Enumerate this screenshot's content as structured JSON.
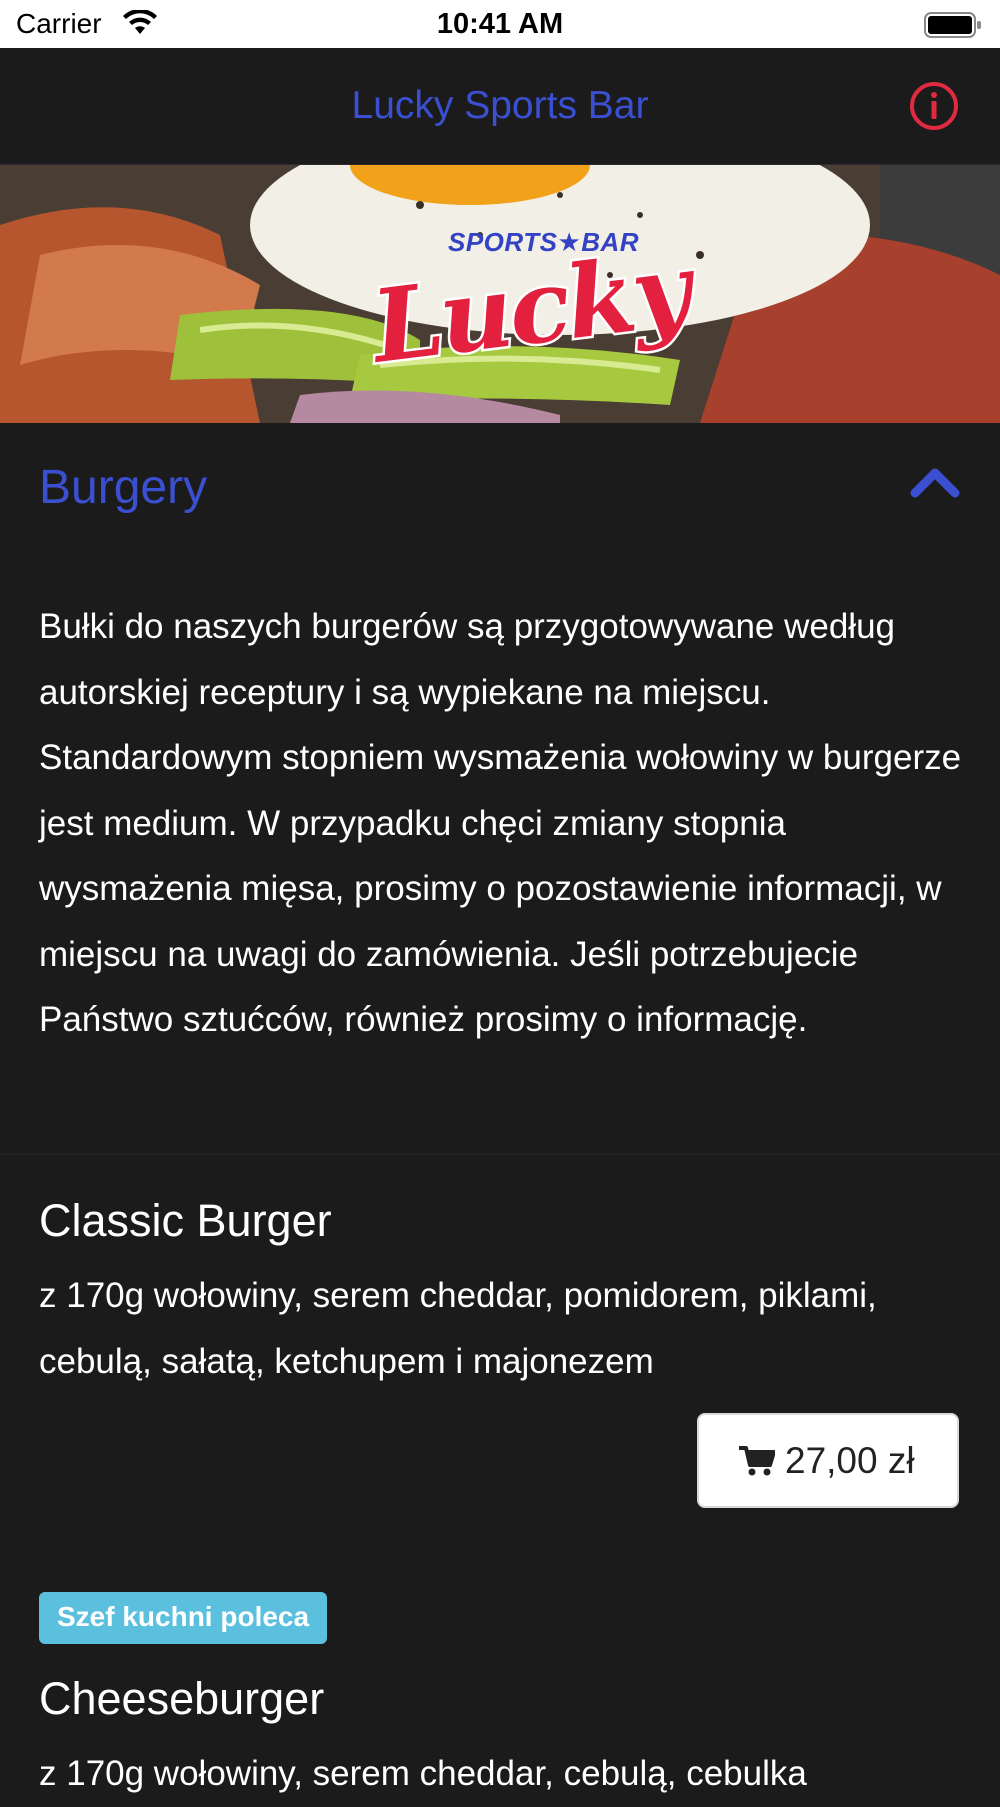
{
  "status_bar": {
    "carrier": "Carrier",
    "time": "10:41 AM"
  },
  "nav": {
    "title": "Lucky Sports Bar",
    "info_icon": "info-circle-icon"
  },
  "hero": {
    "logo_sub": "SPORTS★BAR",
    "logo_main": "Lucky"
  },
  "colors": {
    "accent": "#3b4fd1",
    "info_red": "#e02a3f",
    "badge": "#5bc0de",
    "background": "#1b1b1c"
  },
  "section": {
    "title": "Burgery",
    "description": "Bułki do naszych burgerów są przygotowywane według autorskiej receptury i są wypiekane na miejscu. Standardowym stopniem wysmażenia wołowiny w burgerze jest medium. W przypadku chęci zmiany stopnia wysmażenia mięsa, prosimy o pozostawienie informacji, w miejscu na uwagi do zamówienia. Jeśli potrzebujecie Państwo sztućców, również prosimy o informację."
  },
  "items": [
    {
      "name": "Classic Burger",
      "description": "z 170g wołowiny, serem cheddar, pomidorem, piklami, cebulą, sałatą, ketchupem i majonezem",
      "price": "27,00 zł"
    },
    {
      "badge": "Szef kuchni poleca",
      "name": "Cheeseburger",
      "description": "z 170g wołowiny, serem cheddar, cebulą, cebulka"
    }
  ]
}
